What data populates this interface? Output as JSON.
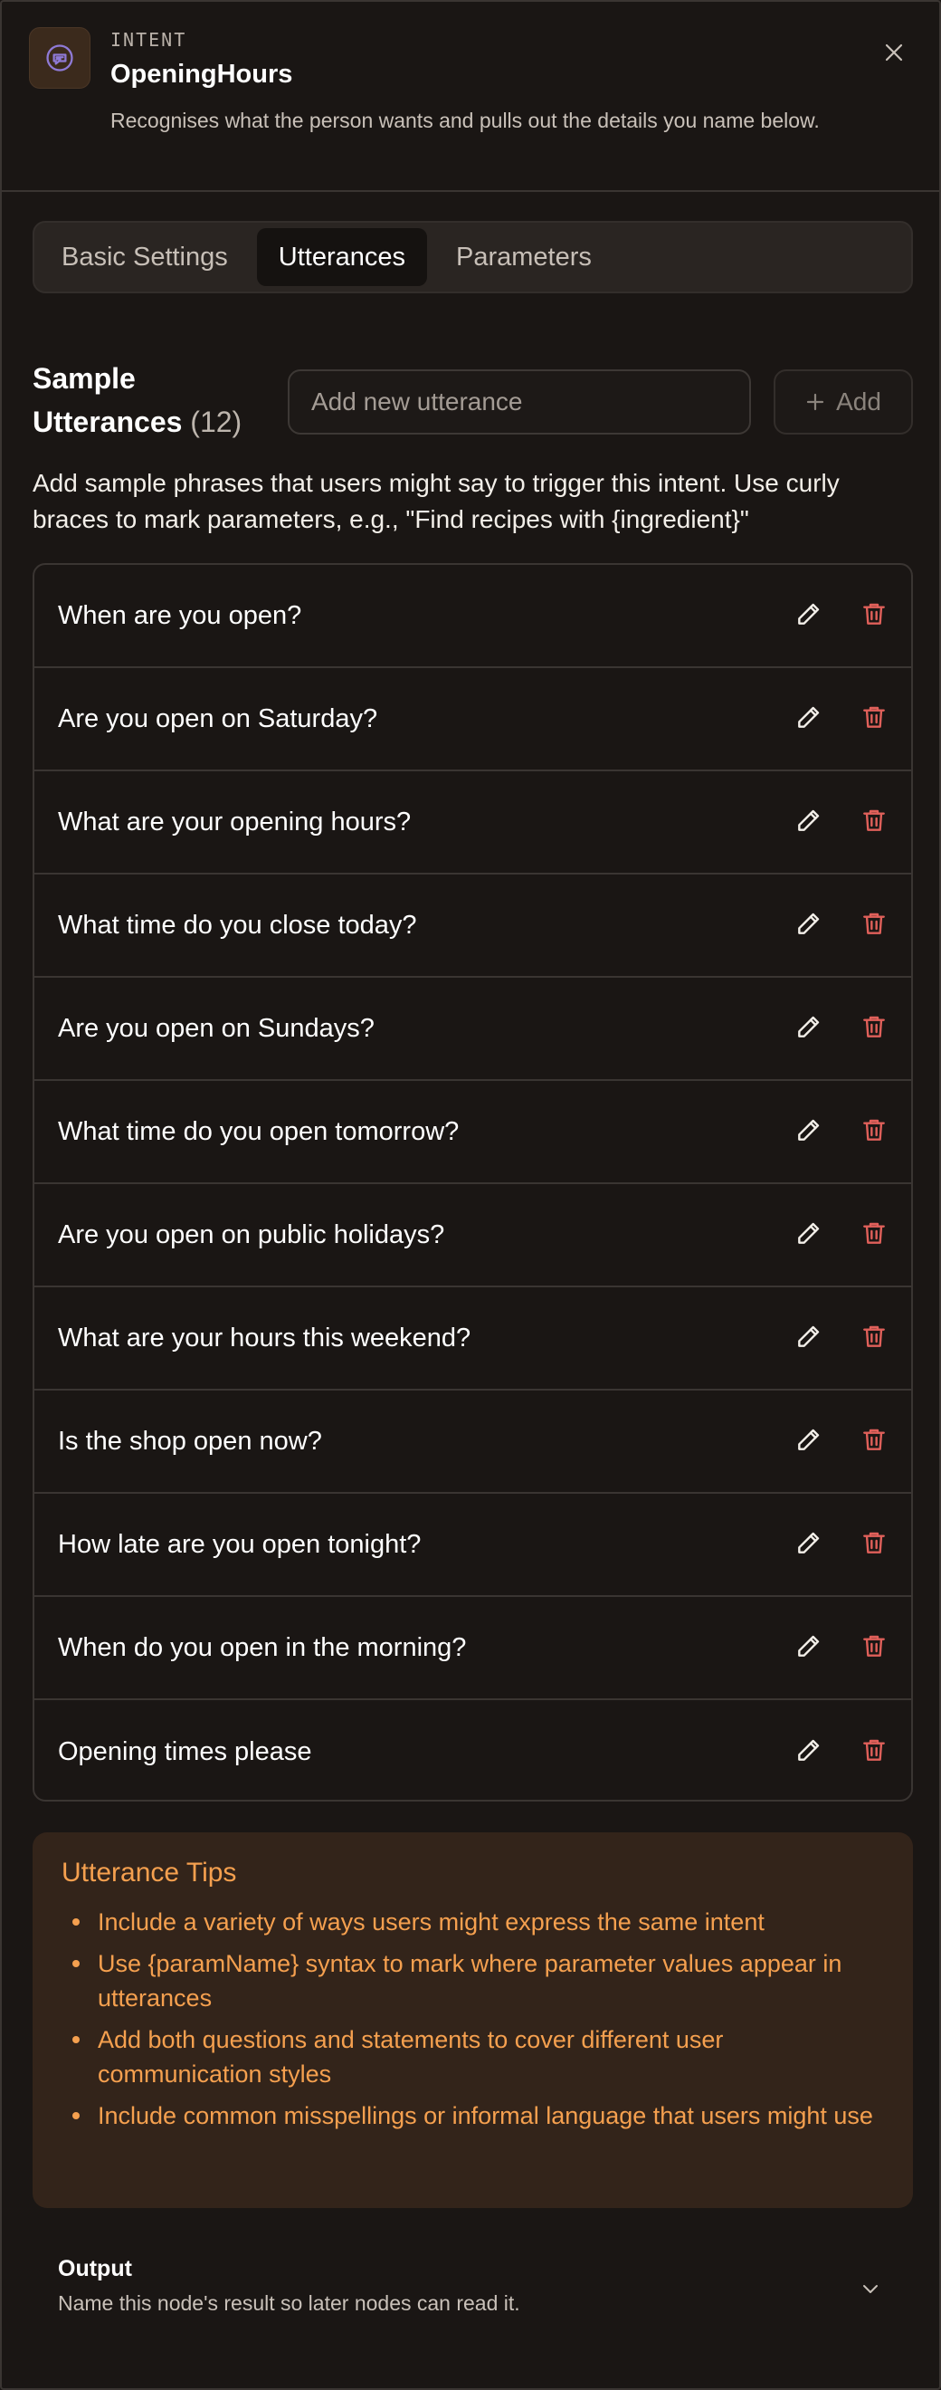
{
  "header": {
    "kicker": "INTENT",
    "title": "OpeningHours",
    "description": "Recognises what the person wants and pulls out the details you name below.",
    "icon": "chat-bubble-icon",
    "close_icon": "close-icon"
  },
  "tabs": [
    {
      "label": "Basic Settings",
      "active": false
    },
    {
      "label": "Utterances",
      "active": true
    },
    {
      "label": "Parameters",
      "active": false
    }
  ],
  "sample_utterances": {
    "title": "Sample Utterances",
    "count": "(12)",
    "input_placeholder": "Add new utterance",
    "add_label": "Add",
    "help_text": "Add sample phrases that users might say to trigger this intent. Use curly braces to mark parameters, e.g., \"Find recipes with {ingredient}\""
  },
  "utterances": [
    "When are you open?",
    "Are you open on Saturday?",
    "What are your opening hours?",
    "What time do you close today?",
    "Are you open on Sundays?",
    "What time do you open tomorrow?",
    "Are you open on public holidays?",
    "What are your hours this weekend?",
    "Is the shop open now?",
    "How late are you open tonight?",
    "When do you open in the morning?",
    "Opening times please"
  ],
  "tips": {
    "title": "Utterance Tips",
    "items": [
      "Include a variety of ways users might express the same intent",
      "Use {paramName} syntax to mark where parameter values appear in utterances",
      "Add both questions and statements to cover different user communication styles",
      "Include common misspellings or informal language that users might use"
    ]
  },
  "output": {
    "title": "Output",
    "subtitle": "Name this node's result so later nodes can read it."
  },
  "colors": {
    "background": "#1a1614",
    "accent_orange": "#f5a04f",
    "delete_red": "#e0605a",
    "icon_purple": "#8f7ad6"
  }
}
